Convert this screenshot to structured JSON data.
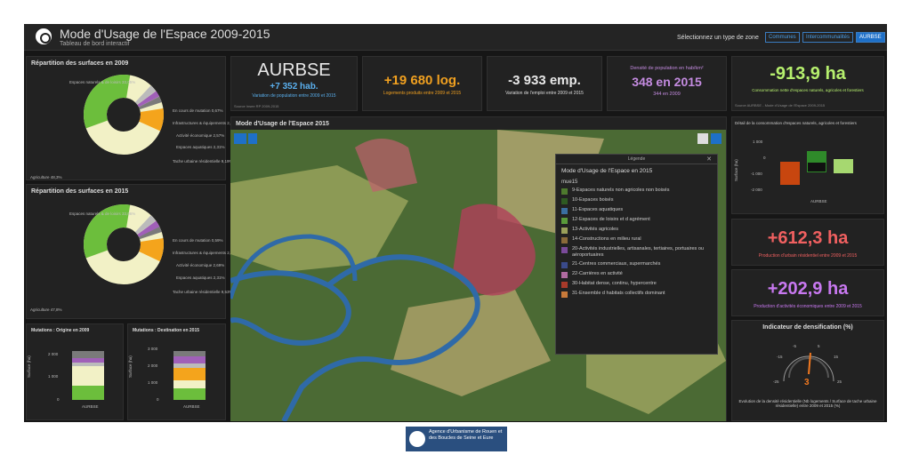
{
  "header": {
    "title": "Mode d'Usage de l'Espace 2009-2015",
    "subtitle": "Tableau de bord interactif",
    "zone_label": "Sélectionnez un type de zone",
    "zone_buttons": [
      "Communes",
      "Intercommunalités",
      "AURBSE"
    ]
  },
  "pie2009": {
    "title": "Répartition des surfaces en 2009",
    "labels": [
      "Espaces naturels & de loisirs 33,05%",
      "En cours de mutation 0,67%",
      "Infrastructures & équipements 2,91%",
      "Activité économique 2,57%",
      "Espaces aquatiques 2,31%",
      "Tache urbaine résidentielle 9,19%",
      "Agriculture 48,3%"
    ]
  },
  "pie2015": {
    "title": "Répartition des surfaces en 2015",
    "labels": [
      "Espaces naturels & de loisirs 33,06%",
      "En cours de mutation 0,59%",
      "Infrastructures & équipements 2,97%",
      "Activité économique 2,69%",
      "Espaces aquatiques 2,31%",
      "Tache urbaine résidentielle 9,53%",
      "Agriculture 47,8%"
    ]
  },
  "mut_origin": {
    "title": "Mutations : Origine en 2009",
    "ylabel": "Surface (ha)",
    "ticks": [
      "2 000",
      "1 000",
      "0"
    ],
    "xlabel": "AURBSE"
  },
  "mut_dest": {
    "title": "Mutations : Destination en 2015",
    "ylabel": "Surface (ha)",
    "ticks": [
      "3 000",
      "2 000",
      "1 000",
      "0"
    ],
    "xlabel": "AURBSE"
  },
  "kpi_zone": {
    "name": "AURBSE",
    "value": "+7 352 hab.",
    "label": "Variation de population entre 2009 et 2015",
    "source": "Source Insee RP 2009-2015"
  },
  "kpi_log": {
    "value": "+19 680 log.",
    "label": "Logements produits entre 2009 et 2015"
  },
  "kpi_emp": {
    "value": "-3 933 emp.",
    "label": "Variation de l'emploi entre 2009 et 2015"
  },
  "kpi_dens": {
    "label": "Densité de population en hab/km²",
    "value": "348 en 2015",
    "sub": "344 en 2009"
  },
  "kpi_conso": {
    "value": "-913,9 ha",
    "label": "Consommation nette d'espaces naturels, agricoles et forestiers",
    "source": "Source AURBSE - Mode d'Usage de l'Espace 2009-2015"
  },
  "detail": {
    "title": "Détail de la consommation d'espaces naturels, agricoles et forestiers",
    "ylabel": "Surface (ha)",
    "ticks": [
      "1 000",
      "0",
      "-1 000",
      "-2 000"
    ],
    "xlabel": "AURBSE"
  },
  "kpi_res": {
    "value": "+612,3 ha",
    "label": "Production d'urbain résidentiel entre 2009 et 2015"
  },
  "kpi_eco": {
    "value": "+202,9 ha",
    "label": "Production d'activités économiques entre 2009 et 2015"
  },
  "gauge": {
    "title": "Indicateur de densification (%)",
    "ticks": [
      "-25",
      "-15",
      "-5",
      "5",
      "15",
      "25"
    ],
    "value": "3",
    "label": "Evolution de la densité résidentielle (Nb logements / Surface de tache urbaine résidentielle) entre 2009 et 2015 (%)"
  },
  "map": {
    "title": "Mode d'Usage de l'Espace 2015"
  },
  "legend": {
    "header": "Légende",
    "title": "Mode d'Usage de l'Espace en 2015",
    "field": "mue15",
    "items": [
      {
        "label": "9-Espaces naturels non agricoles non boisés",
        "color": "#4e7a2e"
      },
      {
        "label": "10-Espaces boisés",
        "color": "#2e5a22"
      },
      {
        "label": "11-Espaces aquatiques",
        "color": "#3a6ea0"
      },
      {
        "label": "12-Espaces de loisirs et d agrément",
        "color": "#5a9a3a"
      },
      {
        "label": "13-Activités agricoles",
        "color": "#9aa05a"
      },
      {
        "label": "14-Constructions en milieu rural",
        "color": "#8a6a3a"
      },
      {
        "label": "20-Activités industrielles, artisanales, tertiaires, portuaires ou aéroportuaires",
        "color": "#7a4a9a"
      },
      {
        "label": "21-Centres commerciaux, supermarchés",
        "color": "#3a4a8a"
      },
      {
        "label": "22-Carrières en activité",
        "color": "#b06aa0"
      },
      {
        "label": "30-Habitat dense, continu, hypercentre",
        "color": "#a83a2a"
      },
      {
        "label": "31-Ensemble d habitats collectifs dominant",
        "color": "#c87a3a"
      }
    ]
  },
  "footer": {
    "logo_text": "Agence d'Urbanisme de Rouen et des Boucles de Seine et Eure"
  }
}
